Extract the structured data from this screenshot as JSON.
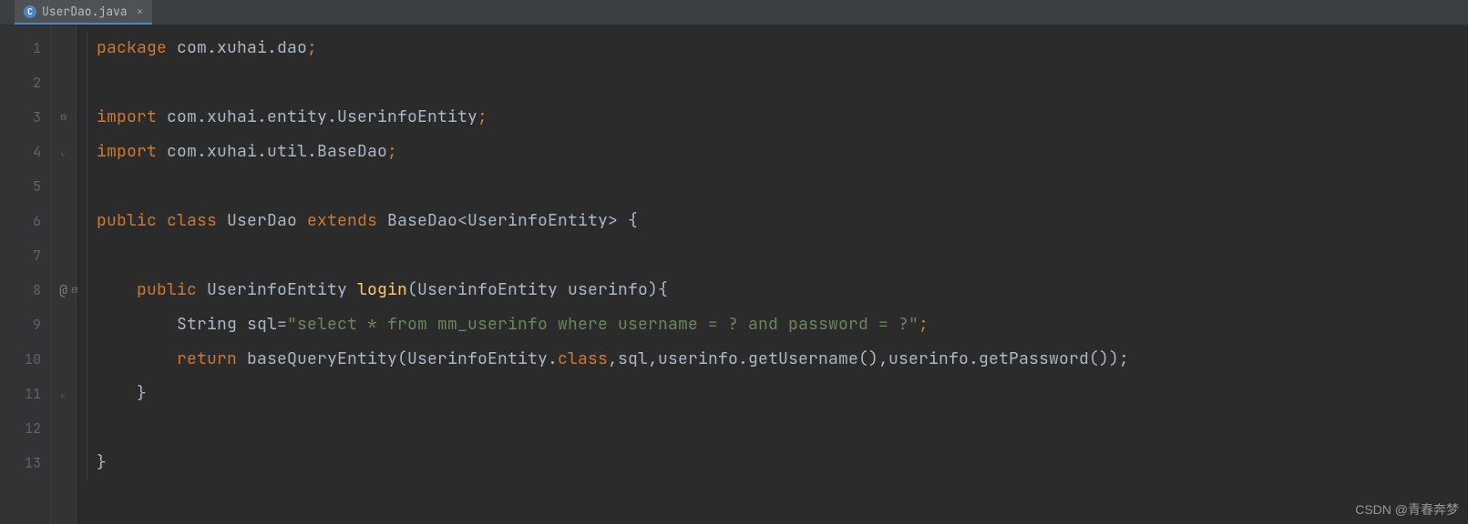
{
  "tab": {
    "icon_letter": "C",
    "filename": "UserDao.java",
    "close_glyph": "×"
  },
  "gutter": {
    "lines": [
      "1",
      "2",
      "3",
      "4",
      "5",
      "6",
      "7",
      "8",
      "9",
      "10",
      "11",
      "12",
      "13"
    ],
    "icon_line8": "@"
  },
  "code": {
    "l1": {
      "t0": "package ",
      "t1": "com.xuhai.dao",
      "t2": ";"
    },
    "l2": "",
    "l3": {
      "t0": "import ",
      "t1": "com.xuhai.entity.UserinfoEntity",
      "t2": ";"
    },
    "l4": {
      "t0": "import ",
      "t1": "com.xuhai.util.BaseDao",
      "t2": ";"
    },
    "l5": "",
    "l6": {
      "t0": "public class ",
      "t1": "UserDao ",
      "t2": "extends ",
      "t3": "BaseDao",
      "t4": "<",
      "t5": "UserinfoEntity",
      "t6": "> {"
    },
    "l7": "",
    "l8": {
      "t0": "    ",
      "t1": "public ",
      "t2": "UserinfoEntity ",
      "t3": "login",
      "t4": "(UserinfoEntity userinfo){"
    },
    "l9": {
      "t0": "        String sql=",
      "t1": "\"select * from mm_userinfo where username = ? and password = ?\"",
      "t2": ";"
    },
    "l10": {
      "t0": "        ",
      "t1": "return ",
      "t2": "baseQueryEntity(UserinfoEntity.",
      "t3": "class",
      "t4": ",sql,userinfo.getUsername(),userinfo.getPassword());"
    },
    "l11": {
      "t0": "    }"
    },
    "l12": "",
    "l13": {
      "t0": "}"
    }
  },
  "watermark": "CSDN @青春奔梦"
}
